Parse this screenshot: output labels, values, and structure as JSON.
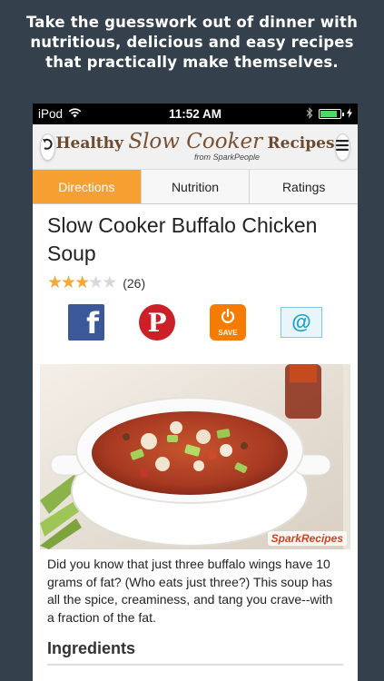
{
  "promo": {
    "lines": [
      "Take the guesswork out of dinner with",
      "nutritious, delicious and easy recipes",
      "that practically make themselves."
    ]
  },
  "status_bar": {
    "carrier": "iPod",
    "time": "11:52 AM",
    "icons": [
      "wifi-icon",
      "bluetooth-icon",
      "battery-icon",
      "charging-icon"
    ],
    "battery_level": 0.85
  },
  "header": {
    "logo_word1": "Healthy",
    "logo_script": "Slow Cooker",
    "logo_word2": "Recipes",
    "logo_sub": "from SparkPeople",
    "back_icon": "back-arrow-icon",
    "menu_icon": "hamburger-menu-icon"
  },
  "tabs": [
    {
      "label": "Directions",
      "active": true
    },
    {
      "label": "Nutrition",
      "active": false
    },
    {
      "label": "Ratings",
      "active": false
    }
  ],
  "recipe": {
    "title": "Slow Cooker Buffalo Chicken Soup",
    "rating": 3,
    "rating_max": 5,
    "rating_count": "(26)",
    "photo_badge": "SparkRecipes",
    "description": "Did you know that just three buffalo wings have 10 grams of fat? (Who eats just three?) This soup has all the spice, creaminess, and tang you crave--with a fraction of the fat.",
    "section_heading": "Ingredients"
  },
  "share": {
    "facebook_glyph": "f",
    "pinterest_glyph": "P",
    "save_label": "SAVE",
    "email_glyph": "@"
  },
  "colors": {
    "background": "#34404c",
    "tab_active": "#f5a030",
    "facebook": "#3b5998",
    "pinterest": "#cb2027",
    "save": "#f57c00",
    "star": "#f3a83c"
  }
}
